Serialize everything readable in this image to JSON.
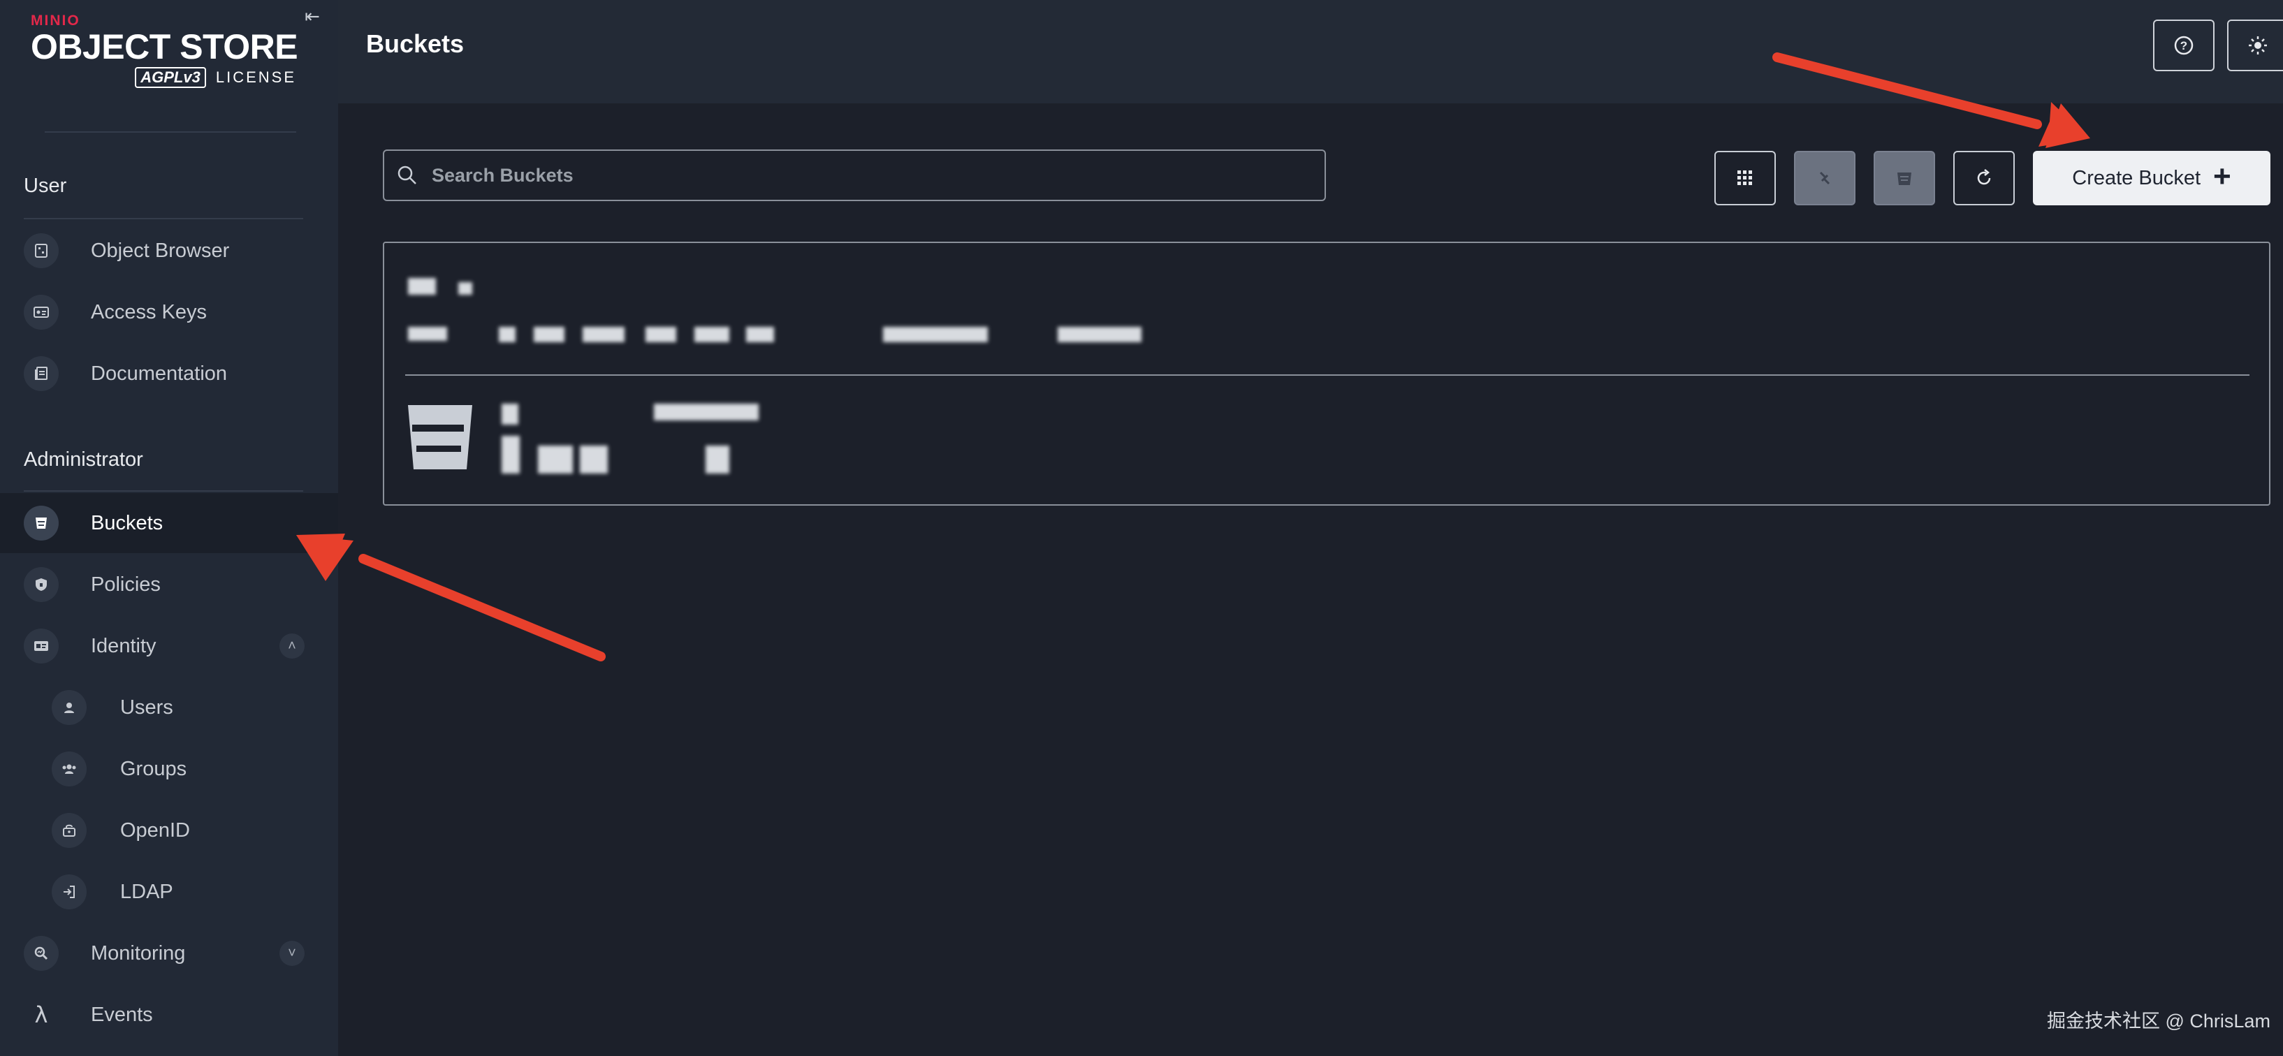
{
  "logo": {
    "brand": "MINIO",
    "product": "OBJECT STORE",
    "license_badge": "AGPLv3",
    "license": "LICENSE"
  },
  "sidebar": {
    "sections": [
      {
        "title": "User",
        "items": [
          {
            "label": "Object Browser",
            "icon": "object-browser-icon"
          },
          {
            "label": "Access Keys",
            "icon": "access-keys-icon"
          },
          {
            "label": "Documentation",
            "icon": "documentation-icon"
          }
        ]
      },
      {
        "title": "Administrator",
        "items": [
          {
            "label": "Buckets",
            "icon": "bucket-icon",
            "active": true
          },
          {
            "label": "Policies",
            "icon": "shield-icon"
          },
          {
            "label": "Identity",
            "icon": "id-card-icon",
            "expanded": true,
            "children": [
              {
                "label": "Users",
                "icon": "user-icon"
              },
              {
                "label": "Groups",
                "icon": "groups-icon"
              },
              {
                "label": "OpenID",
                "icon": "openid-icon"
              },
              {
                "label": "LDAP",
                "icon": "ldap-icon"
              }
            ]
          },
          {
            "label": "Monitoring",
            "icon": "monitoring-icon",
            "expanded": false
          },
          {
            "label": "Events",
            "icon": "lambda-icon"
          }
        ]
      }
    ]
  },
  "header": {
    "title": "Buckets"
  },
  "toolbar": {
    "search_placeholder": "Search Buckets",
    "create_label": "Create Bucket"
  },
  "bucket_card": {
    "content": "redacted (pixelated bucket name, info and stats)"
  },
  "watermark": "掘金技术社区 @ ChrisLam",
  "colors": {
    "sidebar_bg": "#222936",
    "main_bg": "#1c202a",
    "annotation_arrow": "#e8402c",
    "brand": "#e3284a"
  }
}
